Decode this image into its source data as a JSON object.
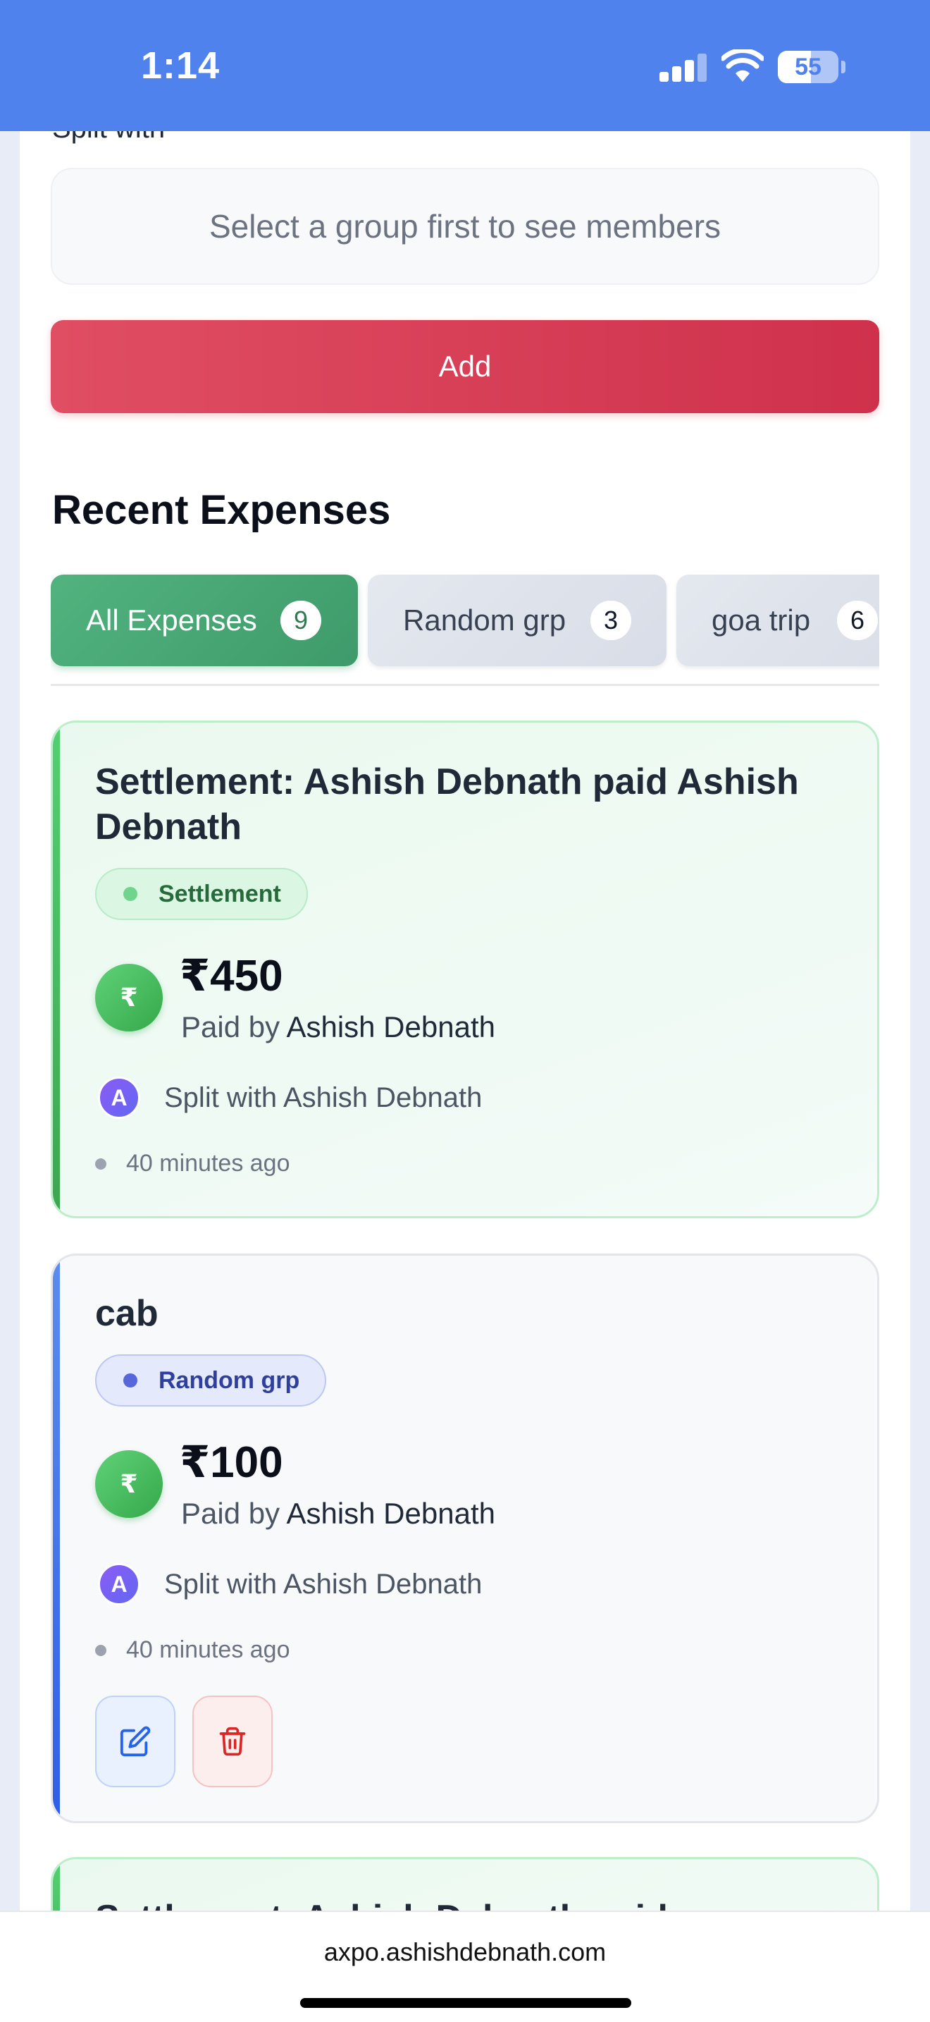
{
  "status_bar": {
    "time": "1:14",
    "battery": "55",
    "battery_level": 0.55
  },
  "form": {
    "split_with_label": "Split with",
    "members_placeholder": "Select a group first to see members",
    "add_button": "Add"
  },
  "recent": {
    "title": "Recent Expenses",
    "tabs": [
      {
        "label": "All Expenses",
        "count": "9",
        "active": true
      },
      {
        "label": "Random grp",
        "count": "3",
        "active": false
      },
      {
        "label": "goa trip",
        "count": "6",
        "active": false
      }
    ]
  },
  "expenses": [
    {
      "title": "Settlement: Ashish Debnath paid Ashish Debnath",
      "tag": "Settlement",
      "amount": "₹450",
      "paid_by_prefix": "Paid by",
      "paid_by": "Ashish Debnath",
      "avatar_initial": "A",
      "split_text": "Split with Ashish Debnath",
      "time": "40 minutes ago"
    },
    {
      "title": "cab",
      "tag": "Random grp",
      "amount": "₹100",
      "paid_by_prefix": "Paid by",
      "paid_by": "Ashish Debnath",
      "avatar_initial": "A",
      "split_text": "Split with Ashish Debnath",
      "time": "40 minutes ago"
    },
    {
      "title": "Settlement: Ashish Debnath paid"
    }
  ],
  "icons": {
    "currency": "₹",
    "edit": "edit-icon",
    "delete": "trash-icon"
  },
  "colors": {
    "header_blue": "#4f82ec",
    "add_red": "#d93d55",
    "active_tab_green": "#48a774",
    "settlement_green": "#3ca64f",
    "expense_blue": "#2e5ee6"
  },
  "browser": {
    "url": "axpo.ashishdebnath.com"
  }
}
